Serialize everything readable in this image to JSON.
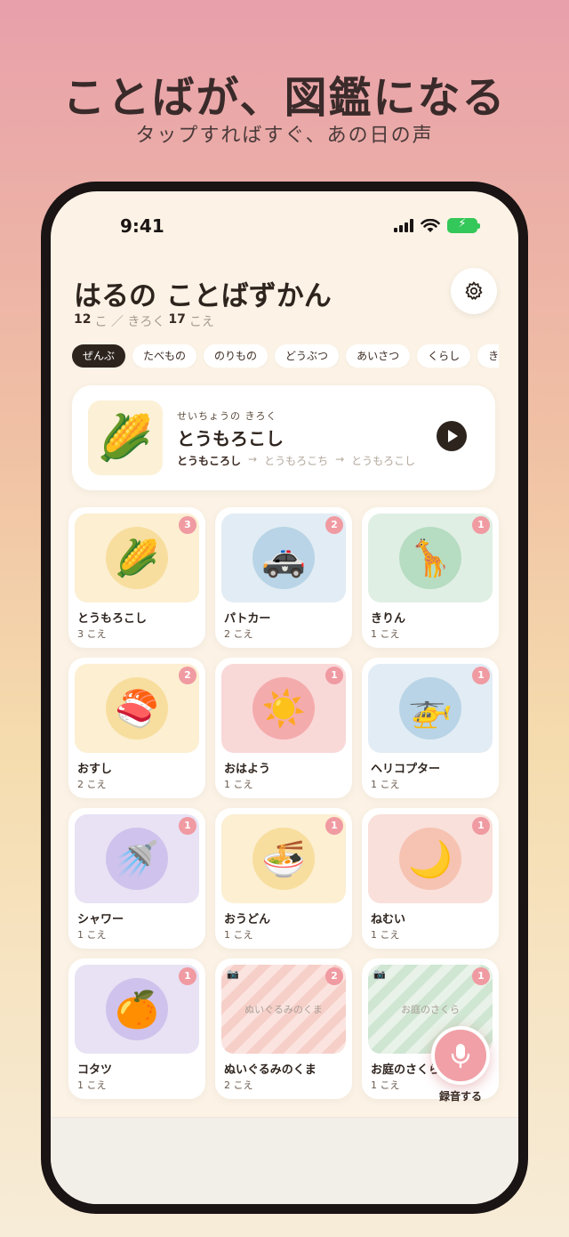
{
  "hero": {
    "title": "ことばが、図鑑になる",
    "subtitle": "タップすればすぐ、あの日の声"
  },
  "status_bar": {
    "time": "9:41",
    "battery_glyph": "⚡"
  },
  "header": {
    "title": "はるの ことばずかん",
    "stats": {
      "words_count": "12",
      "words_unit": "こ ／ きろく",
      "voices_count": "17",
      "voices_unit": "こえ"
    },
    "settings_icon": "gear-icon"
  },
  "categories": [
    "ぜんぶ",
    "たべもの",
    "のりもの",
    "どうぶつ",
    "あいさつ",
    "くらし",
    "き"
  ],
  "active_category": "ぜんぶ",
  "growth_record": {
    "kicker": "せいちょうの きろく",
    "word": "とうもろこし",
    "emoji": "🌽",
    "history": [
      "とうもころし",
      "→",
      "とうもろこち",
      "→",
      "とうもろこし"
    ]
  },
  "cards": [
    {
      "name": "とうもろこし",
      "count": "3 こえ",
      "badge": "3",
      "emoji": "🌽",
      "theme": "yellow"
    },
    {
      "name": "パトカー",
      "count": "2 こえ",
      "badge": "2",
      "emoji": "🚓",
      "theme": "blue"
    },
    {
      "name": "きりん",
      "count": "1 こえ",
      "badge": "1",
      "emoji": "🦒",
      "theme": "green"
    },
    {
      "name": "おすし",
      "count": "2 こえ",
      "badge": "2",
      "emoji": "🍣",
      "theme": "yellow"
    },
    {
      "name": "おはよう",
      "count": "1 こえ",
      "badge": "1",
      "emoji": "☀️",
      "theme": "pink"
    },
    {
      "name": "ヘリコプター",
      "count": "1 こえ",
      "badge": "1",
      "emoji": "🚁",
      "theme": "blue"
    },
    {
      "name": "シャワー",
      "count": "1 こえ",
      "badge": "1",
      "emoji": "🚿",
      "theme": "purple"
    },
    {
      "name": "おうどん",
      "count": "1 こえ",
      "badge": "1",
      "emoji": "🍜",
      "theme": "yellow"
    },
    {
      "name": "ねむい",
      "count": "1 こえ",
      "badge": "1",
      "emoji": "🌙",
      "theme": "peach"
    },
    {
      "name": "コタツ",
      "count": "1 こえ",
      "badge": "1",
      "emoji": "🍊",
      "theme": "purple"
    },
    {
      "name": "ぬいぐるみのくま",
      "count": "2 こえ",
      "badge": "2",
      "photo_label": "ぬいぐるみのくま",
      "theme": "stripe-pink"
    },
    {
      "name": "お庭のさくら",
      "count": "1 こえ",
      "badge": "1",
      "photo_label": "お庭のさくら",
      "theme": "stripe-green"
    }
  ],
  "record_button": {
    "label": "録音する",
    "icon": "microphone-icon"
  },
  "colors": {
    "accent": "#f09aa2",
    "dark": "#2e241e",
    "background": "#fcf3e6"
  }
}
